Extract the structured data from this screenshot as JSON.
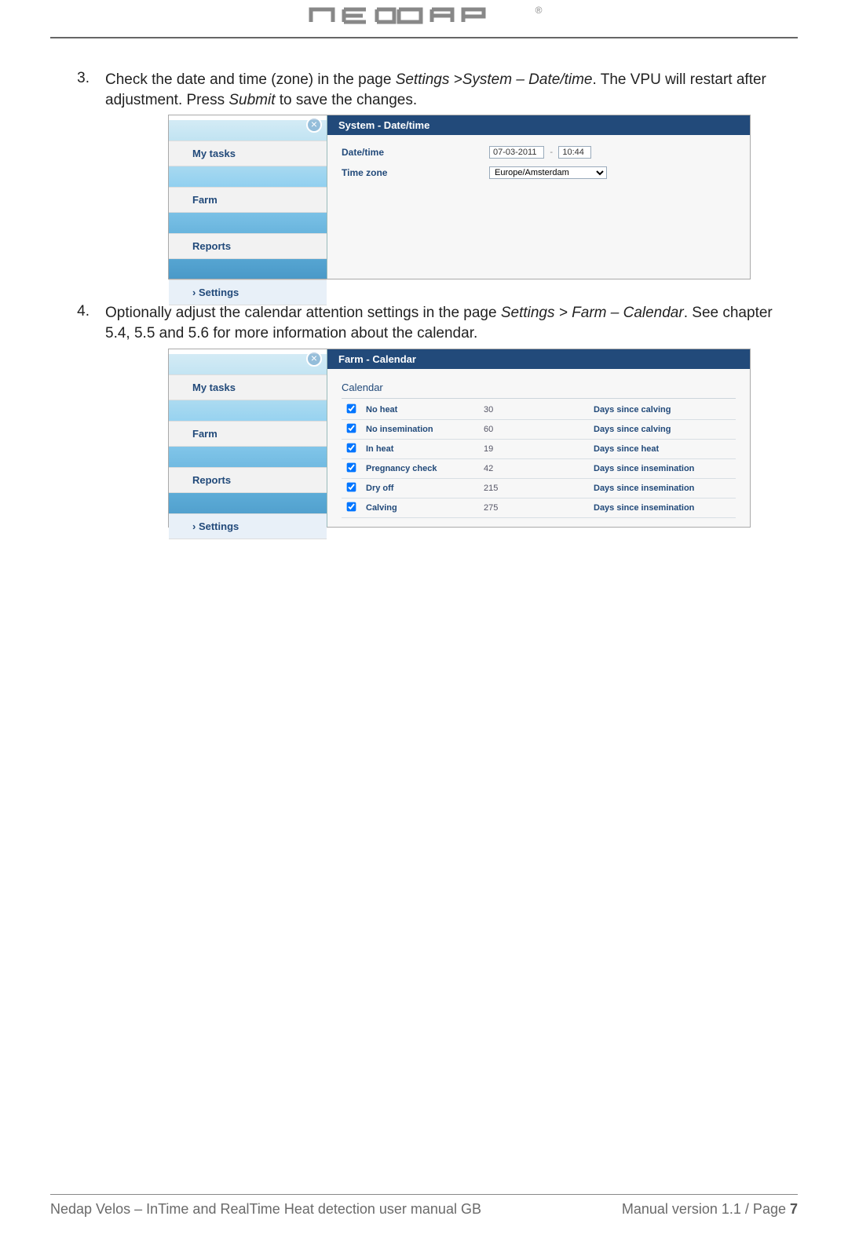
{
  "header": {
    "brand": "nedap"
  },
  "steps": [
    {
      "num": "3.",
      "text_pre": "Check the date and time (zone) in the page ",
      "it1": "Settings >System – Date/time",
      "text_mid": ". The VPU will restart after adjustment. Press ",
      "it2": "Submit",
      "text_post": " to save the changes."
    },
    {
      "num": "4.",
      "text_pre": "Optionally adjust the calendar attention settings in the page ",
      "it1": "Settings > Farm – Calendar",
      "text_mid": ". See chapter 5.4, 5.5 and 5.6 for more information about the calendar.",
      "it2": "",
      "text_post": ""
    }
  ],
  "sidebar": {
    "items": [
      "My tasks",
      "Farm",
      "Reports",
      "Settings"
    ]
  },
  "shot1": {
    "title": "System - Date/time",
    "row1_label": "Date/time",
    "row1_date": "07-03-2011",
    "row1_sep": "-",
    "row1_time": "10:44",
    "row2_label": "Time zone",
    "row2_tz": "Europe/Amsterdam"
  },
  "shot2": {
    "title": "Farm - Calendar",
    "section": "Calendar",
    "rows": [
      {
        "label": "No heat",
        "value": "30",
        "desc": "Days since calving"
      },
      {
        "label": "No insemination",
        "value": "60",
        "desc": "Days since calving"
      },
      {
        "label": "In heat",
        "value": "19",
        "desc": "Days since heat"
      },
      {
        "label": "Pregnancy check",
        "value": "42",
        "desc": "Days since insemination"
      },
      {
        "label": "Dry off",
        "value": "215",
        "desc": "Days since insemination"
      },
      {
        "label": "Calving",
        "value": "275",
        "desc": "Days since insemination"
      }
    ]
  },
  "footer": {
    "left": "Nedap Velos – InTime and RealTime Heat detection user manual GB",
    "right_pre": "Manual version 1.1 / Page ",
    "right_pg": "7"
  }
}
